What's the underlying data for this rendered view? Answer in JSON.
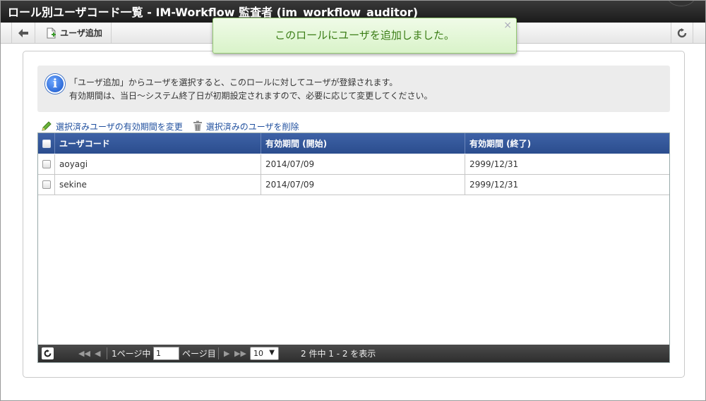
{
  "window": {
    "title": "ロール別ユーザコード一覧 - IM-Workflow 監査者 (im_workflow_auditor)"
  },
  "toolbar": {
    "back_icon": "arrow-left-icon",
    "add_user_label": "ユーザ追加",
    "add_user_icon": "document-add-icon",
    "refresh_icon": "refresh-icon"
  },
  "toast": {
    "message": "このロールにユーザを追加しました。",
    "close": "×"
  },
  "info": {
    "icon": "info-icon",
    "line1": "「ユーザ追加」からユーザを選択すると、このロールに対してユーザが登録されます。",
    "line2": "有効期間は、当日～システム終了日が初期設定されますので、必要に応じて変更してください。"
  },
  "actions": {
    "change_period": "選択済みユーザの有効期間を変更",
    "change_period_icon": "pencil-icon",
    "delete_selected": "選択済みのユーザを削除",
    "delete_selected_icon": "trash-icon"
  },
  "grid": {
    "columns": [
      "ユーザコード",
      "有効期間 (開始)",
      "有効期間 (終了)"
    ],
    "rows": [
      {
        "user_code": "aoyagi",
        "start": "2014/07/09",
        "end": "2999/12/31",
        "checked": false
      },
      {
        "user_code": "sekine",
        "start": "2014/07/09",
        "end": "2999/12/31",
        "checked": false
      }
    ]
  },
  "pager": {
    "page_prefix": "1ページ中",
    "current_page": "1",
    "page_suffix": "ページ目",
    "rows_per_page": "10",
    "summary": "2 件中 1 - 2 を表示"
  },
  "colors": {
    "header_bg": "#2f5597",
    "toast_bg": "#e2f5d5",
    "toast_text": "#3b7d16",
    "link": "#1f4f9e"
  }
}
